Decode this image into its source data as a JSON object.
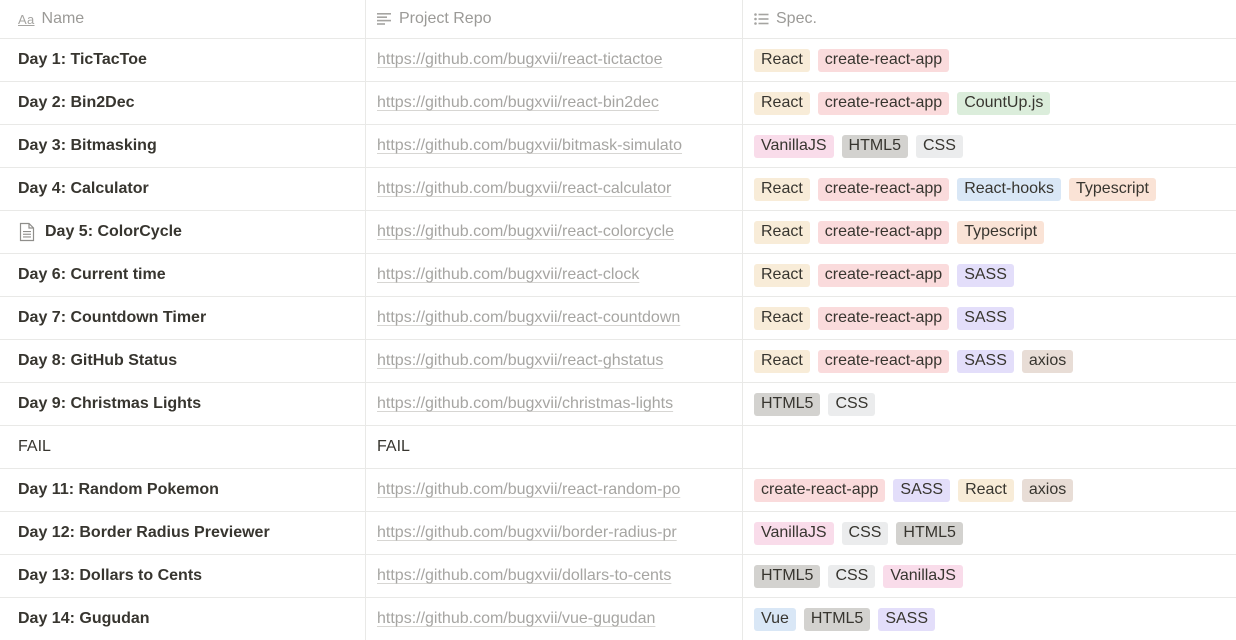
{
  "headers": {
    "name": "Name",
    "name_icon": "Aa",
    "repo": "Project Repo",
    "spec": "Spec."
  },
  "tag_colors": {
    "React": "#f8ecd8",
    "create-react-app": "#fadbdc",
    "CountUp.js": "#dbeddb",
    "VanillaJS": "#f9dcea",
    "HTML5": "#d3d2cf",
    "CSS": "#ebeced",
    "React-hooks": "#d9e7f6",
    "Typescript": "#fae3d6",
    "SASS": "#e3defa",
    "axios": "#e8ddd6",
    "Vue": "#d9e7f6"
  },
  "rows": [
    {
      "name": "Day 1: TicTacToe",
      "repo": "https://github.com/bugxvii/react-tictactoe",
      "tags": [
        "React",
        "create-react-app"
      ]
    },
    {
      "name": "Day 2: Bin2Dec",
      "repo": "https://github.com/bugxvii/react-bin2dec",
      "tags": [
        "React",
        "create-react-app",
        "CountUp.js"
      ]
    },
    {
      "name": "Day 3: Bitmasking",
      "repo": "https://github.com/bugxvii/bitmask-simulato",
      "tags": [
        "VanillaJS",
        "HTML5",
        "CSS"
      ]
    },
    {
      "name": "Day 4: Calculator",
      "repo": "https://github.com/bugxvii/react-calculator",
      "tags": [
        "React",
        "create-react-app",
        "React-hooks",
        "Typescript"
      ]
    },
    {
      "name": "Day 5: ColorCycle",
      "repo": "https://github.com/bugxvii/react-colorcycle",
      "tags": [
        "React",
        "create-react-app",
        "Typescript"
      ],
      "icon": "page-icon"
    },
    {
      "name": "Day 6: Current time",
      "repo": "https://github.com/bugxvii/react-clock",
      "tags": [
        "React",
        "create-react-app",
        "SASS"
      ]
    },
    {
      "name": "Day 7: Countdown Timer",
      "repo": "https://github.com/bugxvii/react-countdown",
      "tags": [
        "React",
        "create-react-app",
        "SASS"
      ]
    },
    {
      "name": "Day 8: GitHub Status",
      "repo": "https://github.com/bugxvii/react-ghstatus",
      "tags": [
        "React",
        "create-react-app",
        "SASS",
        "axios"
      ]
    },
    {
      "name": "Day 9: Christmas Lights",
      "repo": "https://github.com/bugxvii/christmas-lights",
      "tags": [
        "HTML5",
        "CSS"
      ]
    },
    {
      "name": "FAIL",
      "repo": "FAIL",
      "tags": [],
      "plain": true
    },
    {
      "name": "Day 11: Random Pokemon",
      "repo": "https://github.com/bugxvii/react-random-po",
      "tags": [
        "create-react-app",
        "SASS",
        "React",
        "axios"
      ]
    },
    {
      "name": "Day 12: Border Radius Previewer",
      "repo": "https://github.com/bugxvii/border-radius-pr",
      "tags": [
        "VanillaJS",
        "CSS",
        "HTML5"
      ]
    },
    {
      "name": "Day 13: Dollars to Cents",
      "repo": "https://github.com/bugxvii/dollars-to-cents",
      "tags": [
        "HTML5",
        "CSS",
        "VanillaJS"
      ]
    },
    {
      "name": "Day 14: Gugudan",
      "repo": "https://github.com/bugxvii/vue-gugudan",
      "tags": [
        "Vue",
        "HTML5",
        "SASS"
      ]
    }
  ]
}
